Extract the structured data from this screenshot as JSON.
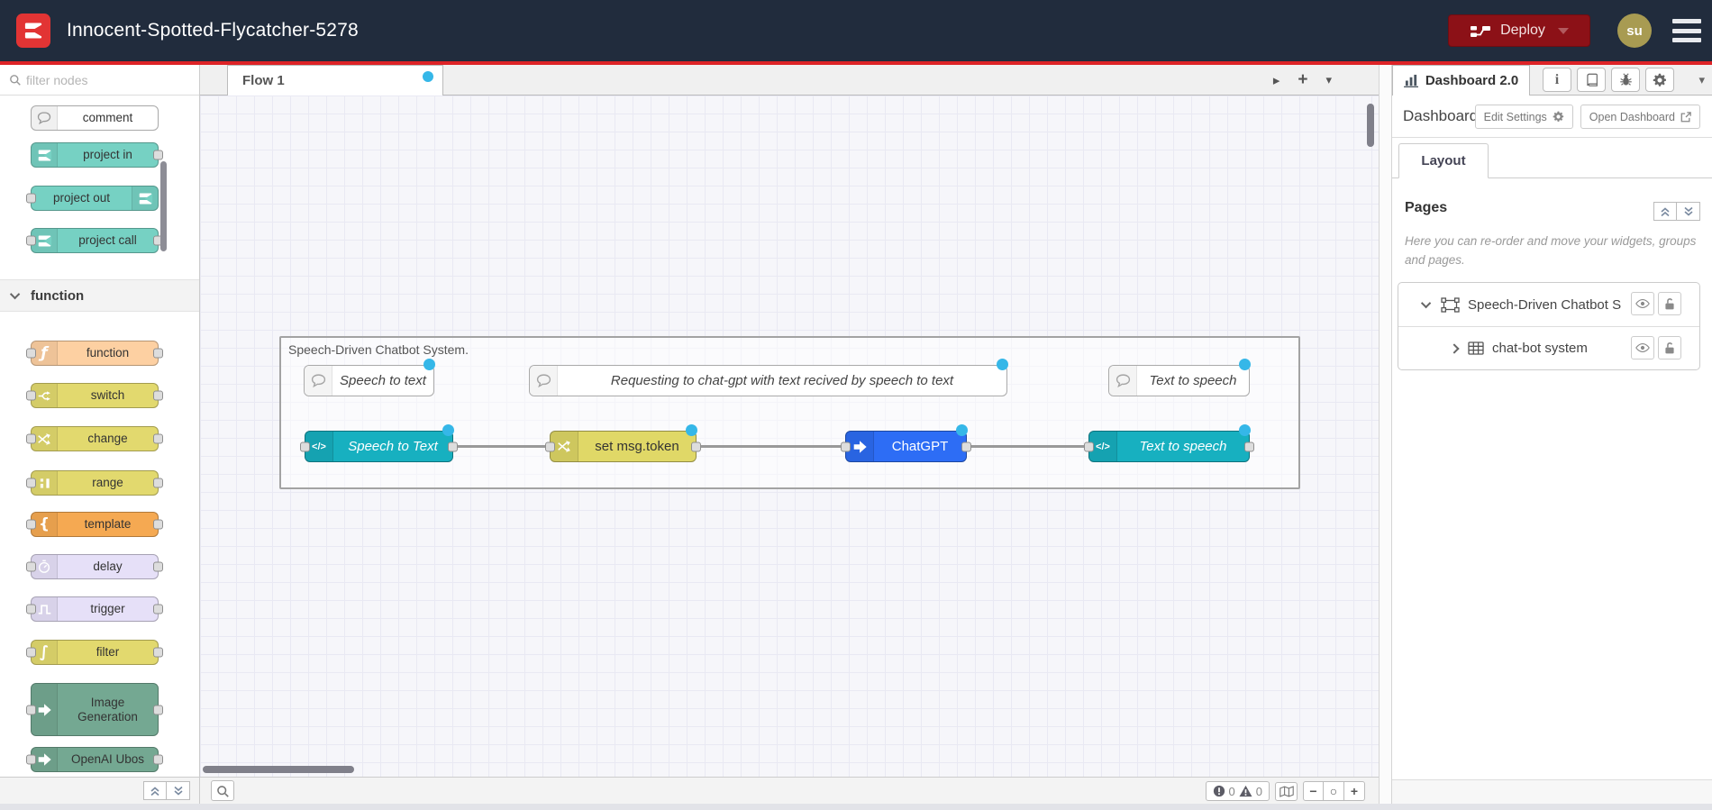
{
  "header": {
    "title": "Innocent-Spotted-Flycatcher-5278",
    "deploy_label": "Deploy",
    "user_initials": "su"
  },
  "palette": {
    "filter_placeholder": "filter nodes",
    "category_label": "function",
    "items": [
      {
        "label": "comment",
        "icon": "comment-bubble-icon"
      },
      {
        "label": "project in",
        "icon": "node-logo-icon"
      },
      {
        "label": "project out",
        "icon": "node-logo-icon"
      },
      {
        "label": "project call",
        "icon": "node-logo-icon"
      },
      {
        "label": "function",
        "icon": "function-f-icon"
      },
      {
        "label": "switch",
        "icon": "switch-icon"
      },
      {
        "label": "change",
        "icon": "change-icon"
      },
      {
        "label": "range",
        "icon": "range-icon"
      },
      {
        "label": "template",
        "icon": "template-brace-icon"
      },
      {
        "label": "delay",
        "icon": "delay-stopwatch-icon"
      },
      {
        "label": "trigger",
        "icon": "trigger-wave-icon"
      },
      {
        "label": "filter",
        "icon": "filter-icon"
      },
      {
        "label": "Image Generation",
        "icon": "block-arrow-icon"
      },
      {
        "label": "OpenAI Ubos",
        "icon": "block-arrow-icon"
      }
    ]
  },
  "canvas": {
    "tab_label": "Flow 1"
  },
  "flow": {
    "group_label": "Speech-Driven Chatbot System.",
    "comments": [
      {
        "label": "Speech to text"
      },
      {
        "label": "Requesting to chat-gpt with text recived by speech to text"
      },
      {
        "label": "Text to speech"
      }
    ],
    "nodes": [
      {
        "label": "Speech to Text"
      },
      {
        "label": "set msg.token"
      },
      {
        "label": "ChatGPT"
      },
      {
        "label": "Text to speech"
      }
    ]
  },
  "sidebar": {
    "tab_label": "Dashboard 2.0",
    "section_title": "Dashboard",
    "edit_settings_label": "Edit Settings",
    "open_dashboard_label": "Open Dashboard",
    "layout_tab_label": "Layout",
    "pages_title": "Pages",
    "pages_help": "Here you can re-order and move your widgets, groups and pages.",
    "tree": [
      {
        "label": "Speech-Driven Chatbot S"
      },
      {
        "label": "chat-bot system"
      }
    ]
  },
  "statusbar": {
    "error_count": "0",
    "warning_count": "0"
  },
  "colors": {
    "header_bg": "#212c3d",
    "accent_red": "#dd2327",
    "deploy_bg": "#8c1117",
    "avatar_bg": "#a89b52",
    "project_teal": "#76d1c3",
    "node_teal": "#17b0c0",
    "node_yellow": "#e0d867",
    "node_blue": "#2d6df5",
    "node_green": "#74a892",
    "node_peach": "#fdd0a2",
    "node_orange": "#f5a952",
    "node_lavender": "#e6e0f8",
    "changed_dot": "#35b7e8"
  }
}
